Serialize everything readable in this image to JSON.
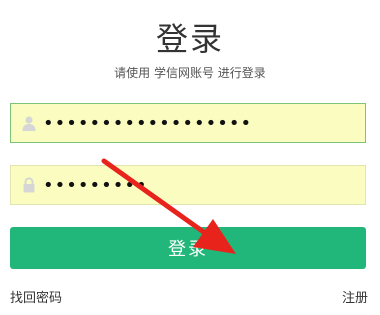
{
  "login": {
    "title": "登录",
    "subtitle": "请使用 学信网账号 进行登录",
    "username_value": "••••••••••••••••••",
    "password_value": "•••••••••",
    "submit_label": "登录",
    "forgot_label": "找回密码",
    "register_label": "注册"
  },
  "colors": {
    "accent": "#22b77a",
    "field_background": "#fafdbf",
    "annotation_arrow": "#e8231c"
  },
  "icons": {
    "username": "user-icon",
    "password": "lock-icon"
  }
}
